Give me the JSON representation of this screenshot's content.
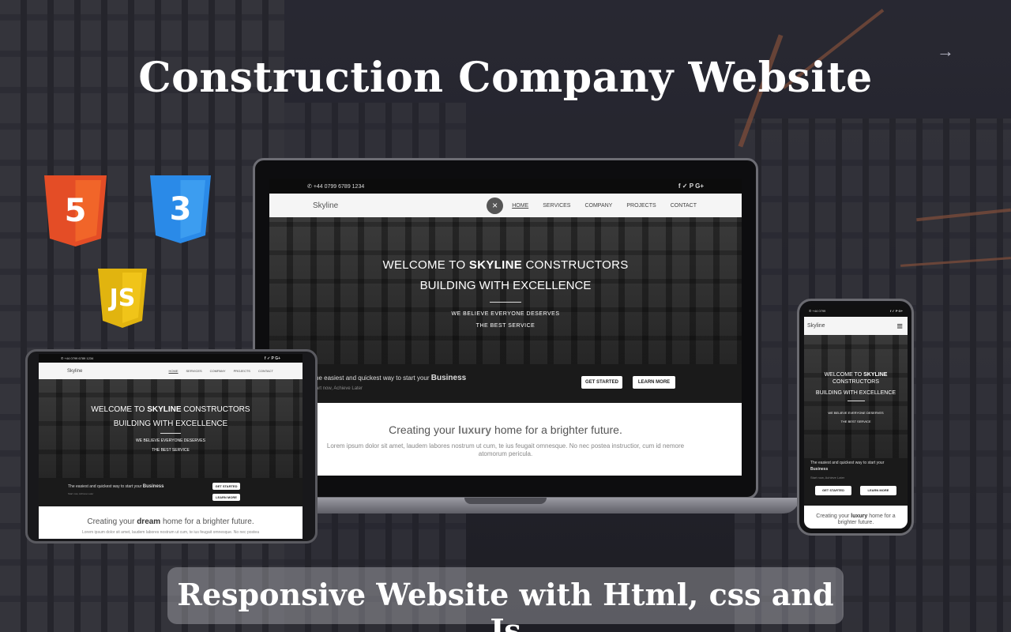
{
  "headline": "Construction Company Website",
  "tagline": "Responsive Website with Html, css and Js",
  "nav_arrow": "→",
  "tech_logos": [
    {
      "name": "html5",
      "glyph": "5",
      "color": "#e44d26"
    },
    {
      "name": "css3",
      "glyph": "3",
      "color": "#2a8ae8"
    },
    {
      "name": "javascript",
      "glyph": "JS",
      "color": "#f0c419"
    }
  ],
  "site": {
    "phone": "+44 0799 6789 1234",
    "phone_short": "+44 0799",
    "social": "f  ✓  P  G+",
    "brand": "Skyline",
    "close_glyph": "×",
    "menu_glyph": "≡",
    "nav": [
      "HOME",
      "SERVICES",
      "COMPANY",
      "PROJECTS",
      "CONTACT"
    ],
    "hero_prefix": "WELCOME TO ",
    "hero_brand": "SKYLINE",
    "hero_suffix": " CONSTRUCTORS",
    "hero_line2": "BUILDING WITH EXCELLENCE",
    "hero_sub1": "WE BELIEVE EVERYONE DESERVES",
    "hero_sub2": "THE BEST SERVICE",
    "band_text": "The easiest and quickest way to start your",
    "band_text_laptop": "he easiest and quickest way to start your",
    "band_bold": "Business",
    "band_small": "Start now, Achieve Later",
    "band_small_laptop": "art now, Achieve Later",
    "btn_start": "GET STARTED",
    "btn_learn": "LEARN MORE",
    "lower_pre": "Creating your ",
    "lower_word_laptop": "luxury",
    "lower_word_tablet": "dream",
    "lower_word_phone": "luxury",
    "lower_post": " home for a brighter future.",
    "lower_post_phone": " home for a brighter future.",
    "lorem": "Lorem ipsum dolor sit amet, laudem labores nostrum ut cum, te ius feugait omnesque. No nec postea instructior, cum id nemore atomorum pericula.",
    "lorem_tablet": "Lorem ipsum dolor sit amet, laudem labores nostrum ut cum, te ius feugait omnesque. No nec postea"
  }
}
